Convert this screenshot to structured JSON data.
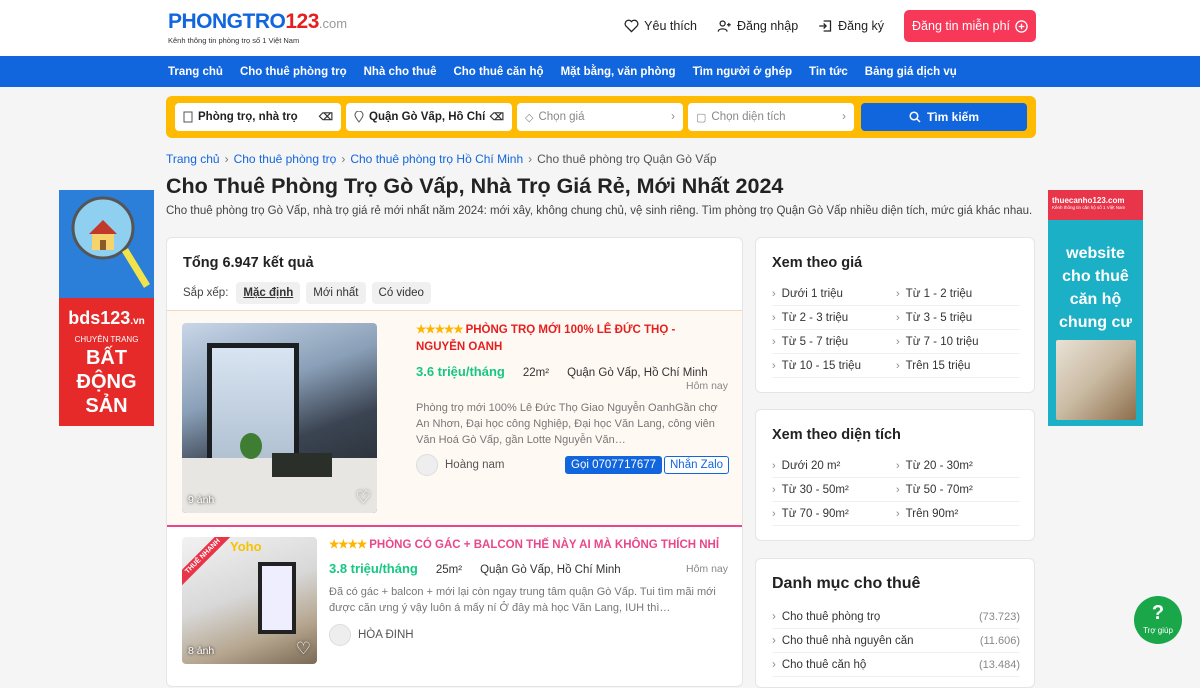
{
  "header": {
    "logo_main": "PHONGTRO",
    "logo_num": "123",
    "logo_tld": ".com",
    "logo_tagline": "Kênh thông tin phòng trọ số 1 Việt Nam",
    "favorites": "Yêu thích",
    "login": "Đăng nhập",
    "register": "Đăng ký",
    "post_button": "Đăng tin miễn phí"
  },
  "nav": [
    "Trang chủ",
    "Cho thuê phòng trọ",
    "Nhà cho thuê",
    "Cho thuê căn hộ",
    "Mặt bằng, văn phòng",
    "Tìm người ở ghép",
    "Tin tức",
    "Bảng giá dịch vụ"
  ],
  "search": {
    "type": "Phòng trọ, nhà trọ",
    "location": "Quận Gò Vấp, Hồ Chí …",
    "price_placeholder": "Chọn giá",
    "area_placeholder": "Chọn diện tích",
    "button": "Tìm kiếm"
  },
  "breadcrumb": [
    "Trang chủ",
    "Cho thuê phòng trọ",
    "Cho thuê phòng trọ Hồ Chí Minh",
    "Cho thuê phòng trọ Quận Gò Vấp"
  ],
  "page_title": "Cho Thuê Phòng Trọ Gò Vấp, Nhà Trọ Giá Rẻ, Mới Nhất 2024",
  "page_desc": "Cho thuê phòng trọ Gò Vấp, nhà trọ giá rẻ mới nhất năm 2024: mới xây, không chung chủ, vệ sinh riêng. Tìm phòng trọ Quận Gò Vấp nhiều diện tích, mức giá khác nhau.",
  "results": {
    "total": "Tổng 6.947 kết quả",
    "sort_label": "Sắp xếp:",
    "sort_options": [
      "Mặc định",
      "Mới nhất",
      "Có video"
    ]
  },
  "listings": [
    {
      "stars": "★★★★★",
      "title": "PHÒNG TRỌ MỚI 100% LÊ ĐỨC THỌ - NGUYỄN OANH",
      "price": "3.6 triệu/tháng",
      "area": "22m²",
      "location": "Quận Gò Vấp, Hồ Chí Minh",
      "time": "Hôm nay",
      "snippet": "Phòng trọ mới 100% Lê Đức Thọ Giao Nguyễn OanhGần chợ An Nhơn, Đại học công Nghiệp, Đại học Văn Lang, công viên Văn Hoá Gò Vấp, gần Lotte Nguyễn Văn…",
      "author": "Hoàng nam",
      "call": "Gọi 0707717677",
      "zalo": "Nhắn Zalo",
      "photos": "9 ảnh"
    },
    {
      "stars": "★★★★",
      "title": "PHÒNG CÓ GÁC + BALCON THẾ NÀY AI MÀ KHÔNG THÍCH NHỈ",
      "price": "3.8 triệu/tháng",
      "area": "25m²",
      "location": "Quận Gò Vấp, Hồ Chí Minh",
      "time": "Hôm nay",
      "snippet": "Đã có gác + balcon + mới lại còn ngay trung tâm quận Gò Vấp. Tui tìm mãi mới được căn ưng ý vậy luôn á mấy ní Ở đây mà học Văn Lang, IUH thì…",
      "author": "HÒA ĐINH",
      "photos": "8 ảnh",
      "ribbon": "THUÊ NHANH",
      "brand": "Yoho"
    }
  ],
  "price_filter": {
    "title": "Xem theo giá",
    "items": [
      "Dưới 1 triệu",
      "Từ 1 - 2 triệu",
      "Từ 2 - 3 triệu",
      "Từ 3 - 5 triệu",
      "Từ 5 - 7 triệu",
      "Từ 7 - 10 triệu",
      "Từ 10 - 15 triệu",
      "Trên 15 triệu"
    ]
  },
  "area_filter": {
    "title": "Xem theo diện tích",
    "items": [
      "Dưới 20 m²",
      "Từ 20 - 30m²",
      "Từ 30 - 50m²",
      "Từ 50 - 70m²",
      "Từ 70 - 90m²",
      "Trên 90m²"
    ]
  },
  "categories": {
    "title": "Danh mục cho thuê",
    "items": [
      {
        "label": "Cho thuê phòng trọ",
        "count": "(73.723)"
      },
      {
        "label": "Cho thuê nhà nguyên căn",
        "count": "(11.606)"
      },
      {
        "label": "Cho thuê căn hộ",
        "count": "(13.484)"
      }
    ]
  },
  "left_banner": {
    "brand": "bds123",
    "brand_tld": ".vn",
    "line1": "CHUYÊN TRANG",
    "line2": "BẤT",
    "line3": "ĐỘNG",
    "line4": "SẢN"
  },
  "right_banner": {
    "brand": "thuecanho123.com",
    "tagline": "Kênh thông tin căn hộ số 1 Việt Nam",
    "line1": "website",
    "line2": "cho thuê",
    "line3": "căn hộ",
    "line4": "chung cư"
  },
  "help": {
    "icon": "?",
    "label": "Trợ giúp"
  },
  "colors": {
    "brand_blue": "#1266dd",
    "brand_red": "#e51f1f",
    "search_yellow": "#febb02",
    "price_green": "#16c784",
    "help_green": "#1aa74a"
  }
}
